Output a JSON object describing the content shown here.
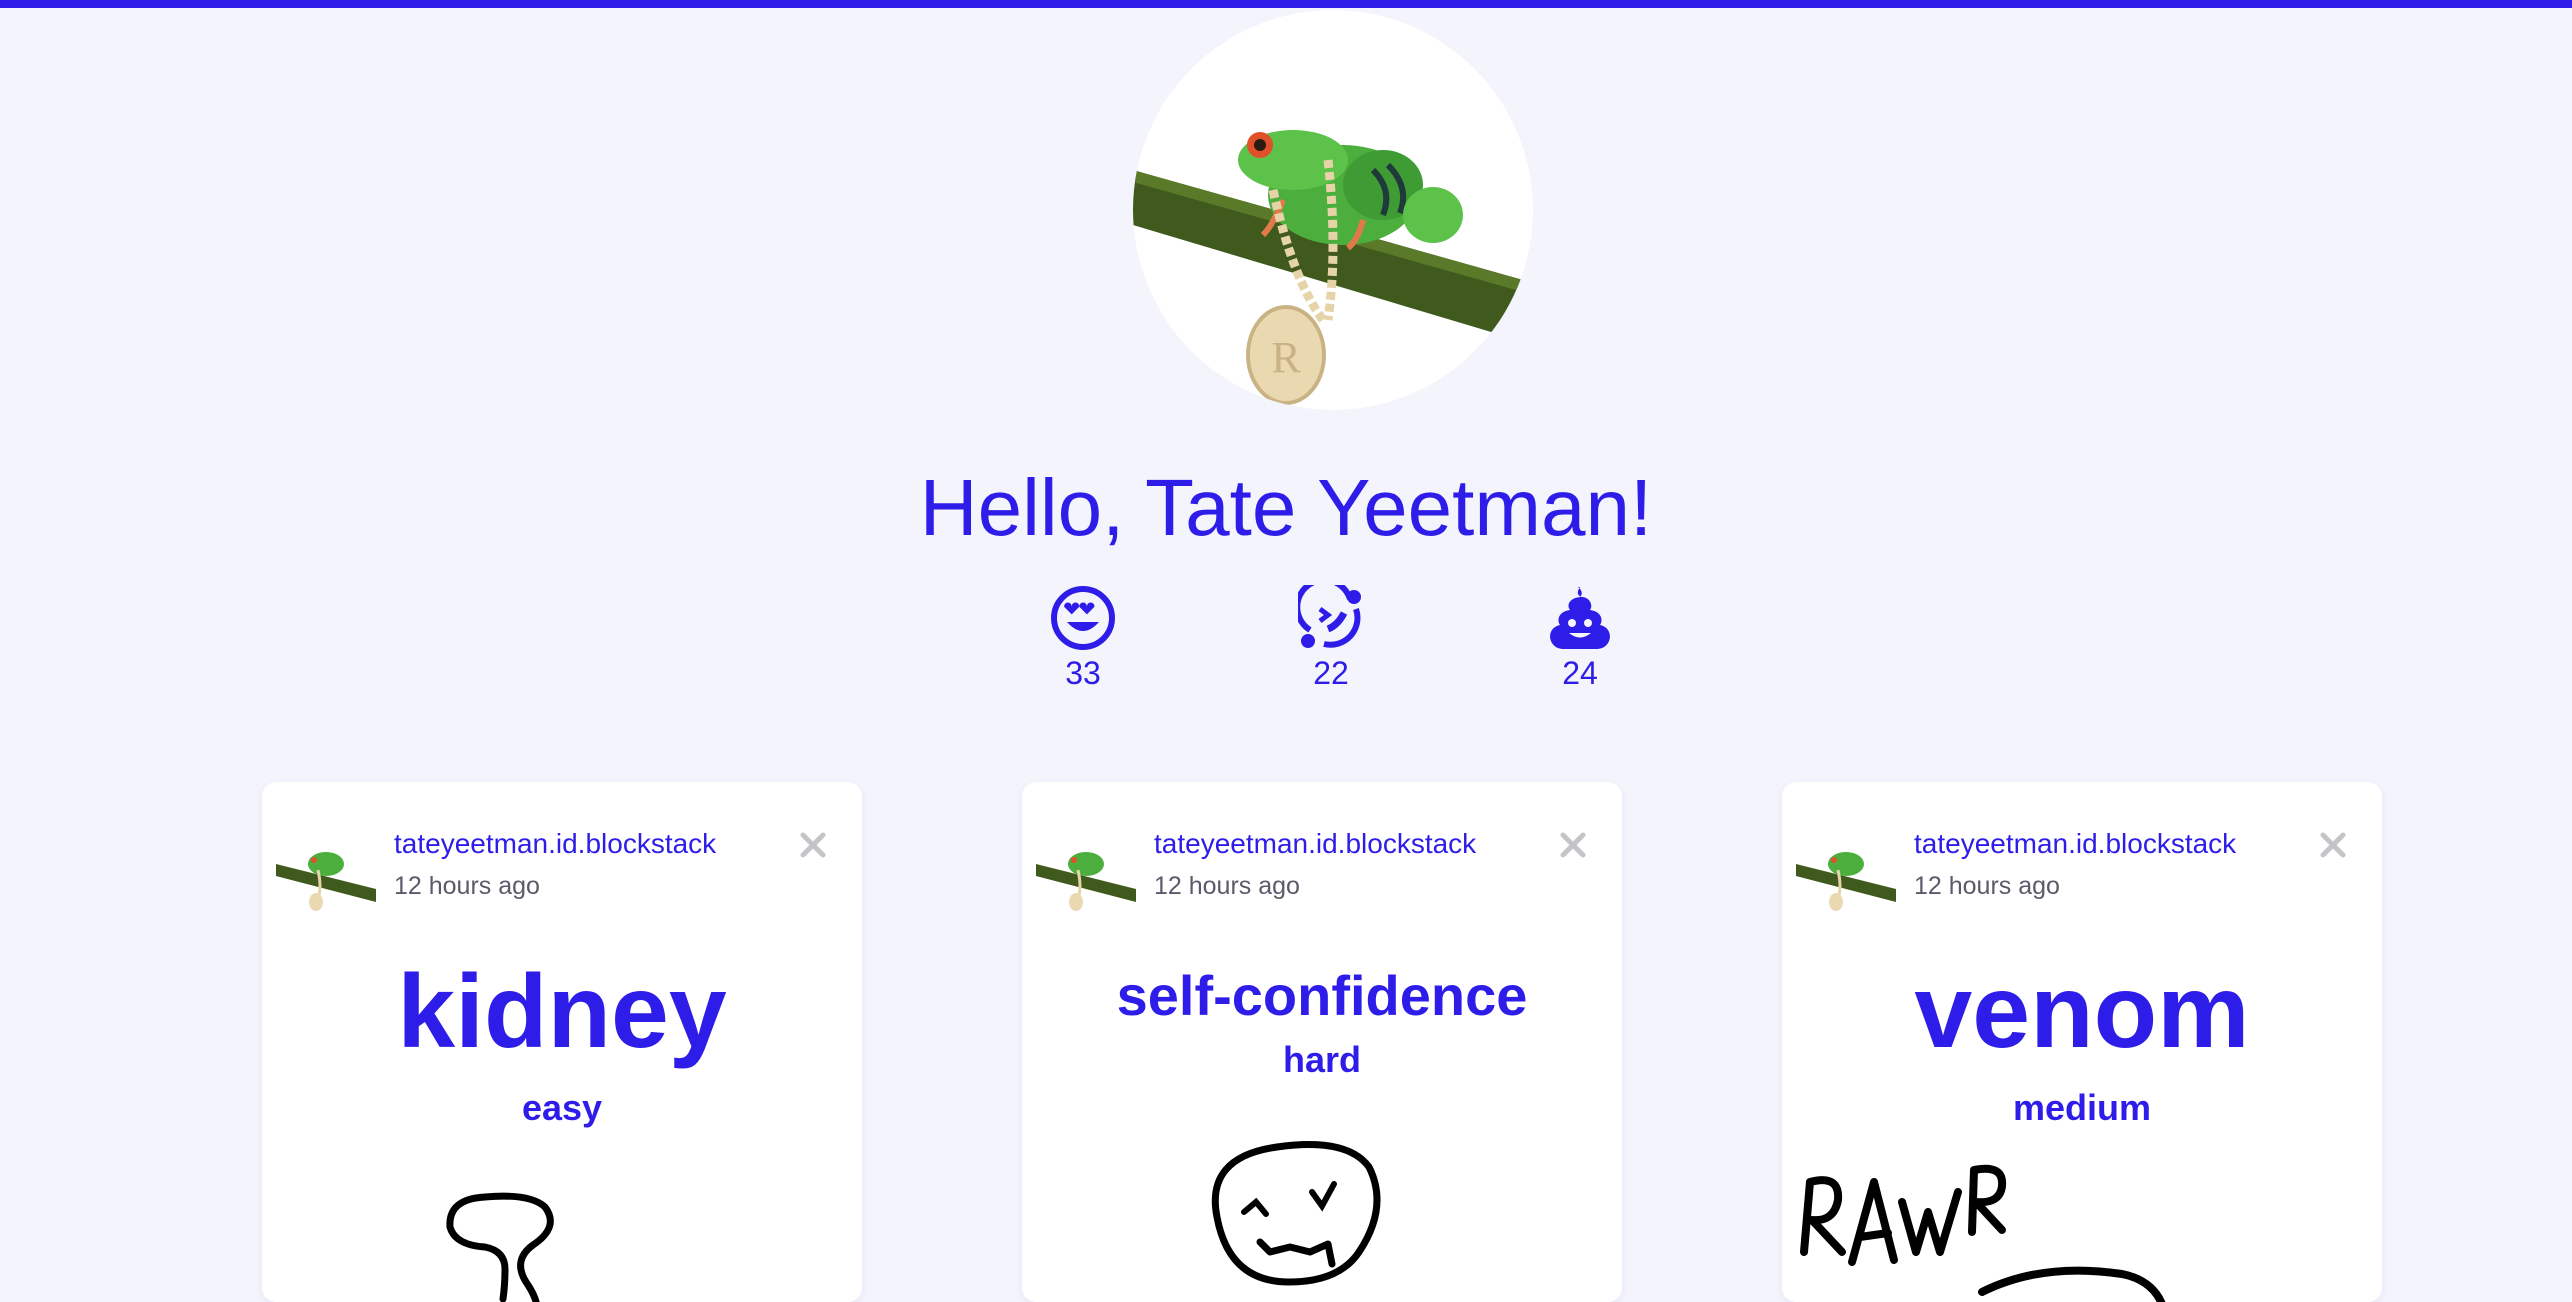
{
  "profile": {
    "greeting": "Hello, Tate Yeetman!",
    "avatar_icon": "frog-with-chain-avatar",
    "accent_color": "#2e1de8"
  },
  "stats": [
    {
      "icon": "heart-eyes-face-icon",
      "count": "33"
    },
    {
      "icon": "swirl-face-icon",
      "count": "22"
    },
    {
      "icon": "poop-icon",
      "count": "24"
    }
  ],
  "cards": [
    {
      "username": "tateyeetman.id.blockstack",
      "time": "12 hours ago",
      "word": "kidney",
      "difficulty": "easy"
    },
    {
      "username": "tateyeetman.id.blockstack",
      "time": "12 hours ago",
      "word": "self-confidence",
      "difficulty": "hard"
    },
    {
      "username": "tateyeetman.id.blockstack",
      "time": "12 hours ago",
      "word": "venom",
      "difficulty": "medium"
    }
  ]
}
